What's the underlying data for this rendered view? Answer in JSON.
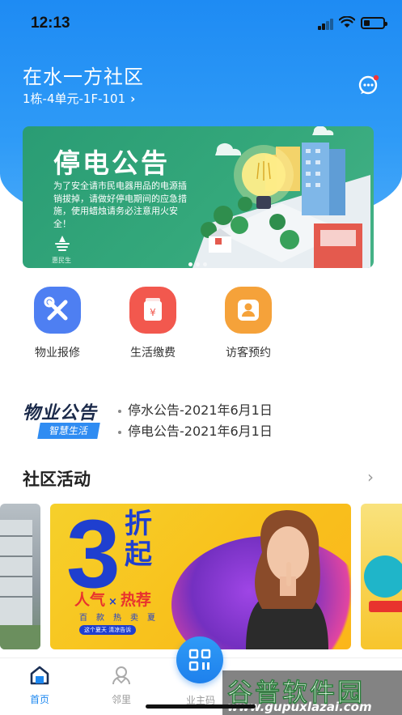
{
  "status_bar": {
    "time": "12:13"
  },
  "header": {
    "community_name": "在水一方社区",
    "address": "1栋-4单元-1F-101",
    "message_icon": "chat-bubble-icon"
  },
  "banner": {
    "title": "停电公告",
    "body": "为了安全请市民电器用品的电源插销拔掉，请做好停电期间的应急措施，使用蜡烛请务必注意用火安全！",
    "logo_text": "惠民生",
    "active_dot": 1,
    "dot_count": 3
  },
  "quick_menu": [
    {
      "label": "物业报修",
      "icon": "repair-tools-icon",
      "color": "#4e7ff2"
    },
    {
      "label": "生活缴费",
      "icon": "payment-wallet-icon",
      "color": "#f2584e"
    },
    {
      "label": "访客预约",
      "icon": "visitor-person-icon",
      "color": "#f5a23a"
    }
  ],
  "notices": {
    "logo_title": "物业公告",
    "logo_tag": "智慧生活",
    "items": [
      "停水公告-2021年6月1日",
      "停电公告-2021年6月1日"
    ]
  },
  "activities": {
    "title": "社区活动",
    "more_icon": "chevron-right-icon",
    "card": {
      "number": "3",
      "zhe": "折起",
      "renqi": "人气",
      "x": "×",
      "rejian": "热荐",
      "chars": "百款热卖夏",
      "pill": "这个夏天 清凉告诉"
    }
  },
  "tabbar": {
    "tabs": [
      {
        "label": "首页",
        "icon": "home-icon",
        "active": true
      },
      {
        "label": "邻里",
        "icon": "neighbors-icon",
        "active": false
      },
      {
        "label": "业主码",
        "icon": "qr-code-icon",
        "active": false
      }
    ]
  },
  "watermark": {
    "main": "谷普软件园",
    "url": "www.gupuxlazai.com"
  },
  "colors": {
    "primary": "#1e88f0",
    "banner_green": "#34a87b"
  }
}
